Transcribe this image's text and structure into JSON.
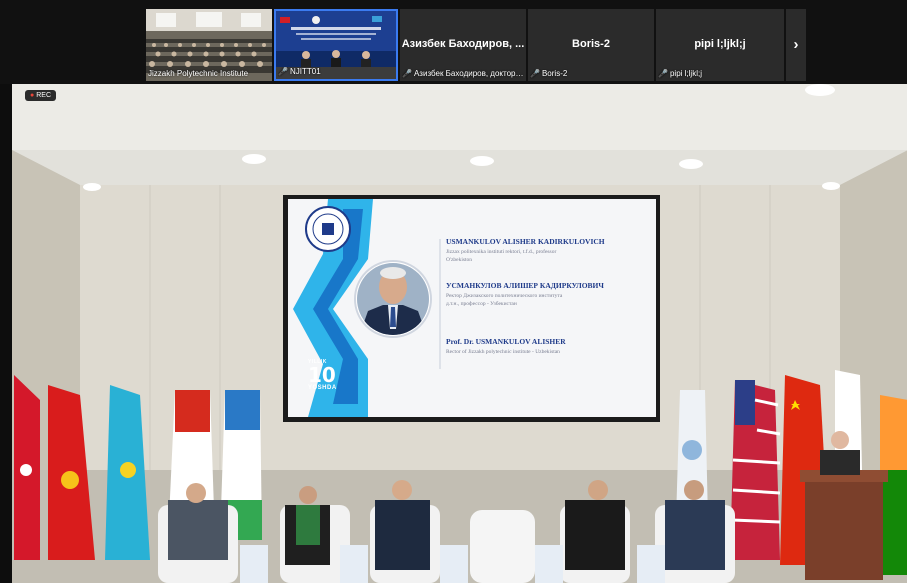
{
  "participants": [
    {
      "name": "Jizzakh Polytechnic Institute",
      "muted": false,
      "type": "video"
    },
    {
      "name": "NJITT01",
      "muted": true,
      "type": "video"
    },
    {
      "name": "Азизбек Баходиров, доктор т...",
      "display_name": "Азизбек Баходиров, ...",
      "muted": true,
      "type": "name"
    },
    {
      "name": "Boris-2",
      "display_name": "Boris-2",
      "muted": true,
      "type": "name"
    },
    {
      "name": "pipi l;ljkl;j",
      "display_name": "pipi l;ljkl;j",
      "muted": true,
      "type": "name"
    }
  ],
  "strip": {
    "next_icon": "chevron-right-icon",
    "next_glyph": "›"
  },
  "recording": {
    "label": "REC",
    "dot": "●"
  },
  "slide": {
    "name_en": "USMANKULOV ALISHER KADIRKULOVICH",
    "sub_en_1": "Jizzax politexnika instituti rektori, t.f.d., professor",
    "sub_en_2": "O'zbekiston",
    "name_ru": "УСМАНКУЛОВ АЛИШЕР КАДИРКУЛОВИЧ",
    "sub_ru_1": "Ректор Джизакского политехнического института",
    "sub_ru_2": "д.т.н., профессор - Узбекистан",
    "name_prof": "Prof. Dr. USMANKULOV ALISHER",
    "sub_prof": "Rector of Jizzakh polytechnic institute - Uzbekistan",
    "badge_top": "YILLIK",
    "badge_num": "10",
    "badge_bottom": "YOSHDA"
  },
  "colors": {
    "mic_off": "#e8463a",
    "active_border": "#3b7bf0",
    "slide_blue": "#1f3b8a",
    "cyan": "#2fb4ea"
  }
}
